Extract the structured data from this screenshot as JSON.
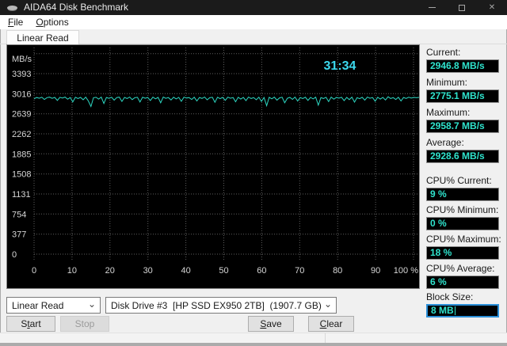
{
  "window": {
    "title": "AIDA64 Disk Benchmark",
    "icons": {
      "app": "disk-icon",
      "minimize": "bar",
      "maximize": "square",
      "close": "✕"
    }
  },
  "menu": {
    "file": {
      "pre": "",
      "key": "F",
      "post": "ile"
    },
    "options": {
      "pre": "",
      "key": "O",
      "post": "ptions"
    }
  },
  "tabs": {
    "active": "Linear Read"
  },
  "panel": {
    "current": {
      "label": "Current:",
      "value": "2946.8 MB/s"
    },
    "minimum": {
      "label": "Minimum:",
      "value": "2775.1 MB/s"
    },
    "maximum": {
      "label": "Maximum:",
      "value": "2958.7 MB/s"
    },
    "average": {
      "label": "Average:",
      "value": "2928.6 MB/s"
    },
    "cpu_current": {
      "label": "CPU% Current:",
      "value": "9 %"
    },
    "cpu_minimum": {
      "label": "CPU% Minimum:",
      "value": "0 %"
    },
    "cpu_maximum": {
      "label": "CPU% Maximum:",
      "value": "18 %"
    },
    "cpu_average": {
      "label": "CPU% Average:",
      "value": "6 %"
    },
    "block_size": {
      "label": "Block Size:",
      "value": "8 MB"
    }
  },
  "controls": {
    "benchmark_select": "Linear Read",
    "drive_select": "Disk Drive #3  [HP SSD EX950 2TB]  (1907.7 GB)",
    "start": {
      "pre": "S",
      "key": "t",
      "post": "art"
    },
    "stop": {
      "pre": "Stop",
      "key": "",
      "post": ""
    },
    "save": {
      "pre": "",
      "key": "S",
      "post": "ave"
    },
    "clear": {
      "pre": "",
      "key": "C",
      "post": "lear"
    }
  },
  "colors": {
    "titlebar": "#1b1b1b",
    "chart_bg": "#000000",
    "line_teal": "#2dd8c3",
    "timer_cyan": "#3cd9ee",
    "value_teal": "#2fe3cd",
    "focus_blue": "#2b8fd8",
    "grid_gray": "#5e5e5e"
  },
  "chart_data": {
    "type": "line",
    "title": "Linear Read",
    "ylabel": "MB/s",
    "x_unit": "%",
    "elapsed_time": "31:34",
    "ylim": [
      0,
      3770
    ],
    "yticks": [
      3393,
      3016,
      2639,
      2262,
      1885,
      1508,
      1131,
      754,
      377,
      0
    ],
    "xticks": [
      0,
      10,
      20,
      30,
      40,
      50,
      60,
      70,
      80,
      90,
      100
    ],
    "grid": true,
    "legend": "none",
    "stats": {
      "current": 2946.8,
      "minimum": 2775.1,
      "maximum": 2958.7,
      "average": 2928.6
    },
    "series": [
      {
        "name": "Linear Read (MB/s)",
        "values": [
          2920,
          2945,
          2930,
          2950,
          2908,
          2942,
          2951,
          2928,
          2947,
          2890,
          2948,
          2935,
          2952,
          2912,
          2944,
          2862,
          2950,
          2926,
          2946,
          2902,
          2951,
          2880,
          2775,
          2940,
          2948,
          2915,
          2952,
          2832,
          2945,
          2928,
          2950,
          2895,
          2943,
          2951,
          2870,
          2946,
          2925,
          2952,
          2905,
          2941,
          2948,
          2860,
          2950,
          2930,
          2945,
          2888,
          2951,
          2920,
          2947,
          2845,
          2952,
          2928,
          2944,
          2898,
          2950,
          2918,
          2946,
          2872,
          2951,
          2935,
          2942,
          2908,
          2950,
          2880,
          2945,
          2927,
          2952,
          2900,
          2940,
          2948,
          2855,
          2950,
          2922,
          2946,
          2892,
          2951,
          2930,
          2944,
          2865,
          2949,
          2915,
          2947,
          2885,
          2952,
          2926,
          2942,
          2902,
          2950,
          2870,
          2945,
          2790,
          2948,
          2920,
          2951,
          2895,
          2938,
          2950,
          2845,
          2928,
          2947,
          2910,
          2952,
          2878,
          2944,
          2924,
          2950,
          2890,
          2946,
          2918,
          2951,
          2800,
          2942,
          2926,
          2948,
          2868,
          2952,
          2912,
          2945,
          2932,
          2950,
          2885,
          2947,
          2905,
          2951,
          2858,
          2940,
          2923,
          2948,
          2895,
          2952,
          2930,
          2944,
          2875,
          2950,
          2916,
          2946,
          2898,
          2958,
          2925,
          2942,
          2908,
          2948,
          2880,
          2945,
          2927,
          2950,
          2935,
          2946,
          2940,
          2947
        ]
      }
    ]
  }
}
